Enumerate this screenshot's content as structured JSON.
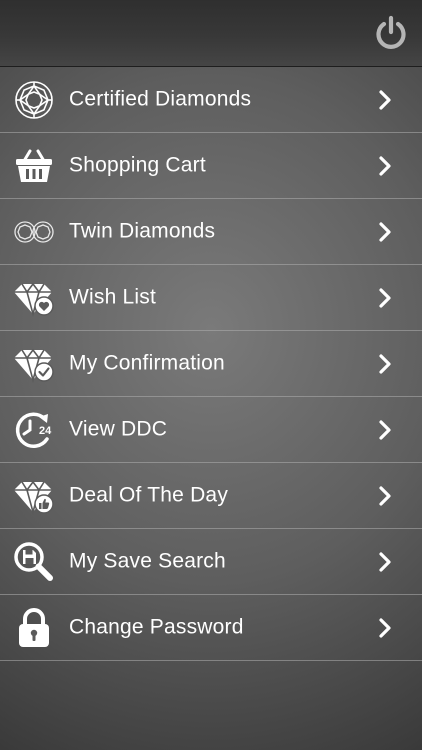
{
  "header": {
    "power_icon": "power-icon"
  },
  "menu": {
    "items": [
      {
        "label": "Certified Diamonds",
        "icon": "diamond-outline-icon"
      },
      {
        "label": "Shopping Cart",
        "icon": "basket-icon"
      },
      {
        "label": "Twin Diamonds",
        "icon": "twin-diamonds-icon"
      },
      {
        "label": "Wish List",
        "icon": "diamond-heart-icon"
      },
      {
        "label": "My Confirmation",
        "icon": "diamond-check-icon"
      },
      {
        "label": "View DDC",
        "icon": "clock-24-icon"
      },
      {
        "label": "Deal Of The Day",
        "icon": "diamond-thumbs-up-icon"
      },
      {
        "label": "My Save Search",
        "icon": "search-save-icon"
      },
      {
        "label": "Change Password",
        "icon": "lock-icon"
      }
    ]
  },
  "colors": {
    "header_bg": "#353535",
    "text": "#ffffff",
    "divider": "#b0b0b0",
    "power_icon": "#b5b5b5"
  }
}
